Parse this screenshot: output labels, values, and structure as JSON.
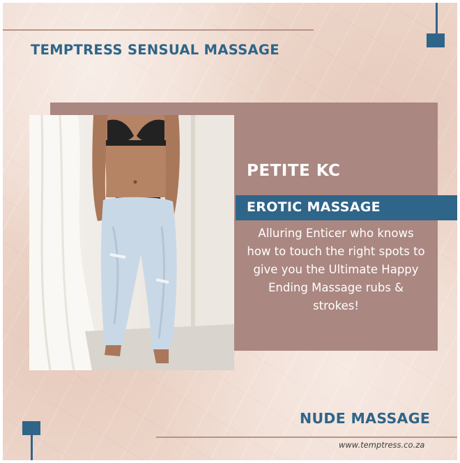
{
  "header": {
    "title": "TEMPTRESS SENSUAL MASSAGE"
  },
  "profile": {
    "name": "PETITE KC",
    "category": "EROTIC MASSAGE",
    "description": "Alluring Enticer who knows how to touch the right spots to give you the Ultimate Happy Ending Massage rubs & strokes!"
  },
  "footer": {
    "service": "NUDE MASSAGE",
    "website": "www.temptress.co.za"
  },
  "colors": {
    "accent_blue": "#2f6589",
    "panel_mauve": "#ab8781",
    "background_paper": "#efd9cd",
    "divider": "#b99488"
  }
}
